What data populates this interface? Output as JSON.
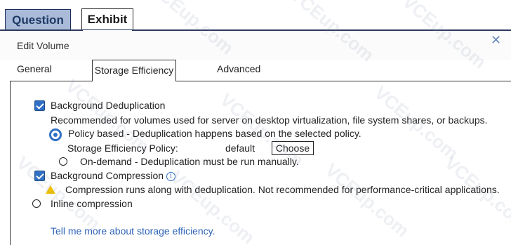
{
  "top_tabs": {
    "question": "Question",
    "exhibit": "Exhibit"
  },
  "dialog": {
    "title": "Edit Volume",
    "close_glyph": "✕"
  },
  "tabs": {
    "general": "General",
    "storage_efficiency": "Storage Efficiency",
    "advanced": "Advanced"
  },
  "dedup": {
    "label": "Background Deduplication",
    "checked": true,
    "description": "Recommended for volumes used for server on desktop virtualization, file system shares, or backups.",
    "policy_based": {
      "label": "Policy based - Deduplication happens based on the selected policy.",
      "selected": true
    },
    "policy_label": "Storage Efficiency Policy:",
    "policy_value": "default",
    "choose_button": "Choose",
    "on_demand": {
      "label": "On-demand - Deduplication must be run manually.",
      "selected": false
    }
  },
  "compression": {
    "label": "Background Compression",
    "checked": true,
    "info_glyph": "i",
    "warning": "Compression runs along with deduplication. Not recommended for performance-critical applications.",
    "inline_label": "Inline compression",
    "inline_selected": false
  },
  "help_link": "Tell me more about storage efficiency.",
  "watermark_text": "VCEup.com",
  "colors": {
    "accent": "#2f6fc4",
    "link": "#2e63b8",
    "question_tab_bg": "#a9bbd9",
    "warning": "#f2c200"
  }
}
